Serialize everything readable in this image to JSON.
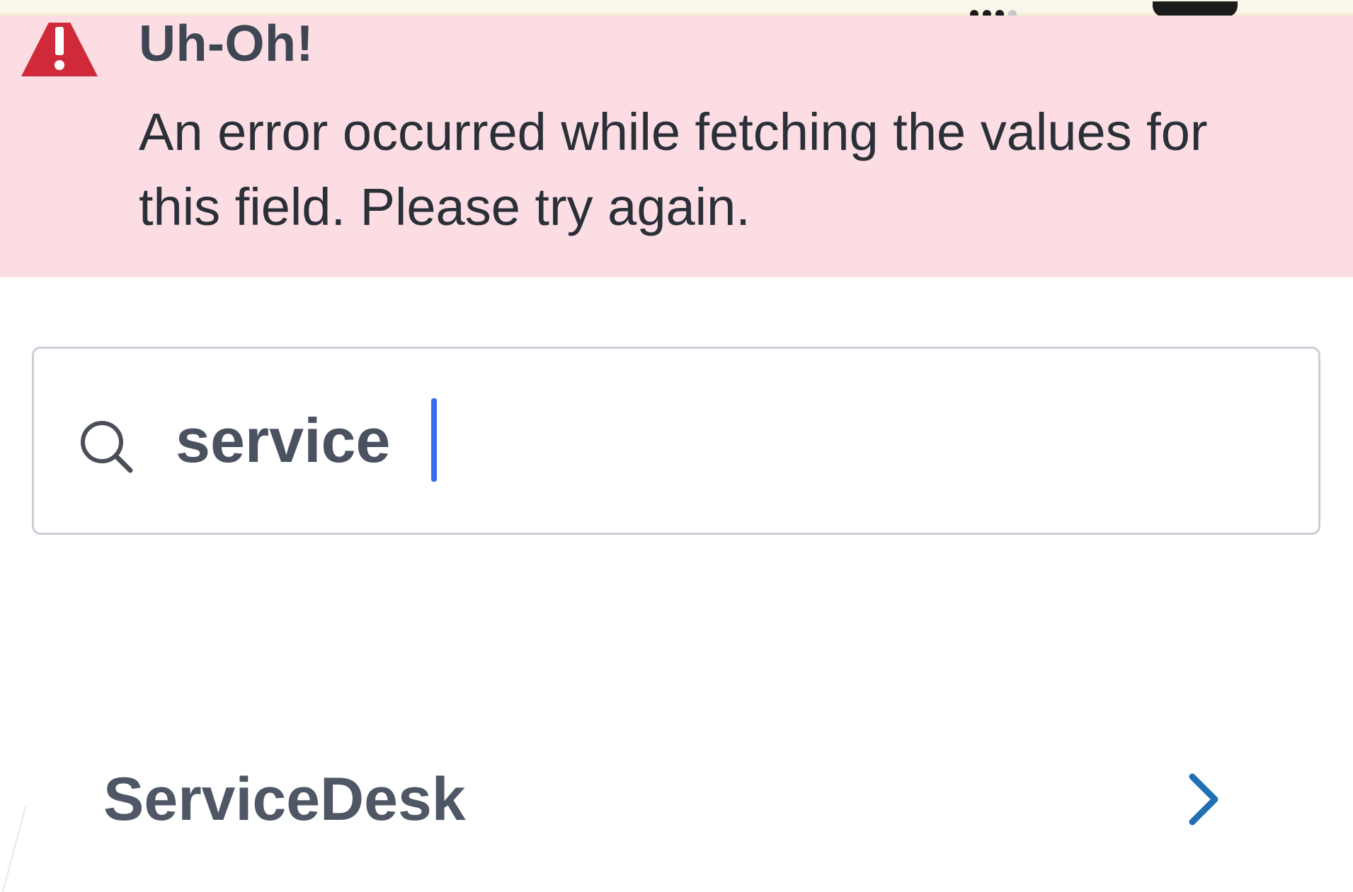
{
  "banner": {
    "title": "Uh-Oh!",
    "message": "An error occurred while fetching the values for this field. Please try again.",
    "icon": "warning-icon",
    "background_color": "#fbdde3",
    "icon_color": "#d02a3a"
  },
  "search": {
    "icon": "search-icon",
    "value": "service",
    "caret_color": "#3a6cf0"
  },
  "results": [
    {
      "label": "ServiceDesk",
      "icon": "chevron-right-icon",
      "icon_color": "#1f6fb2"
    }
  ]
}
